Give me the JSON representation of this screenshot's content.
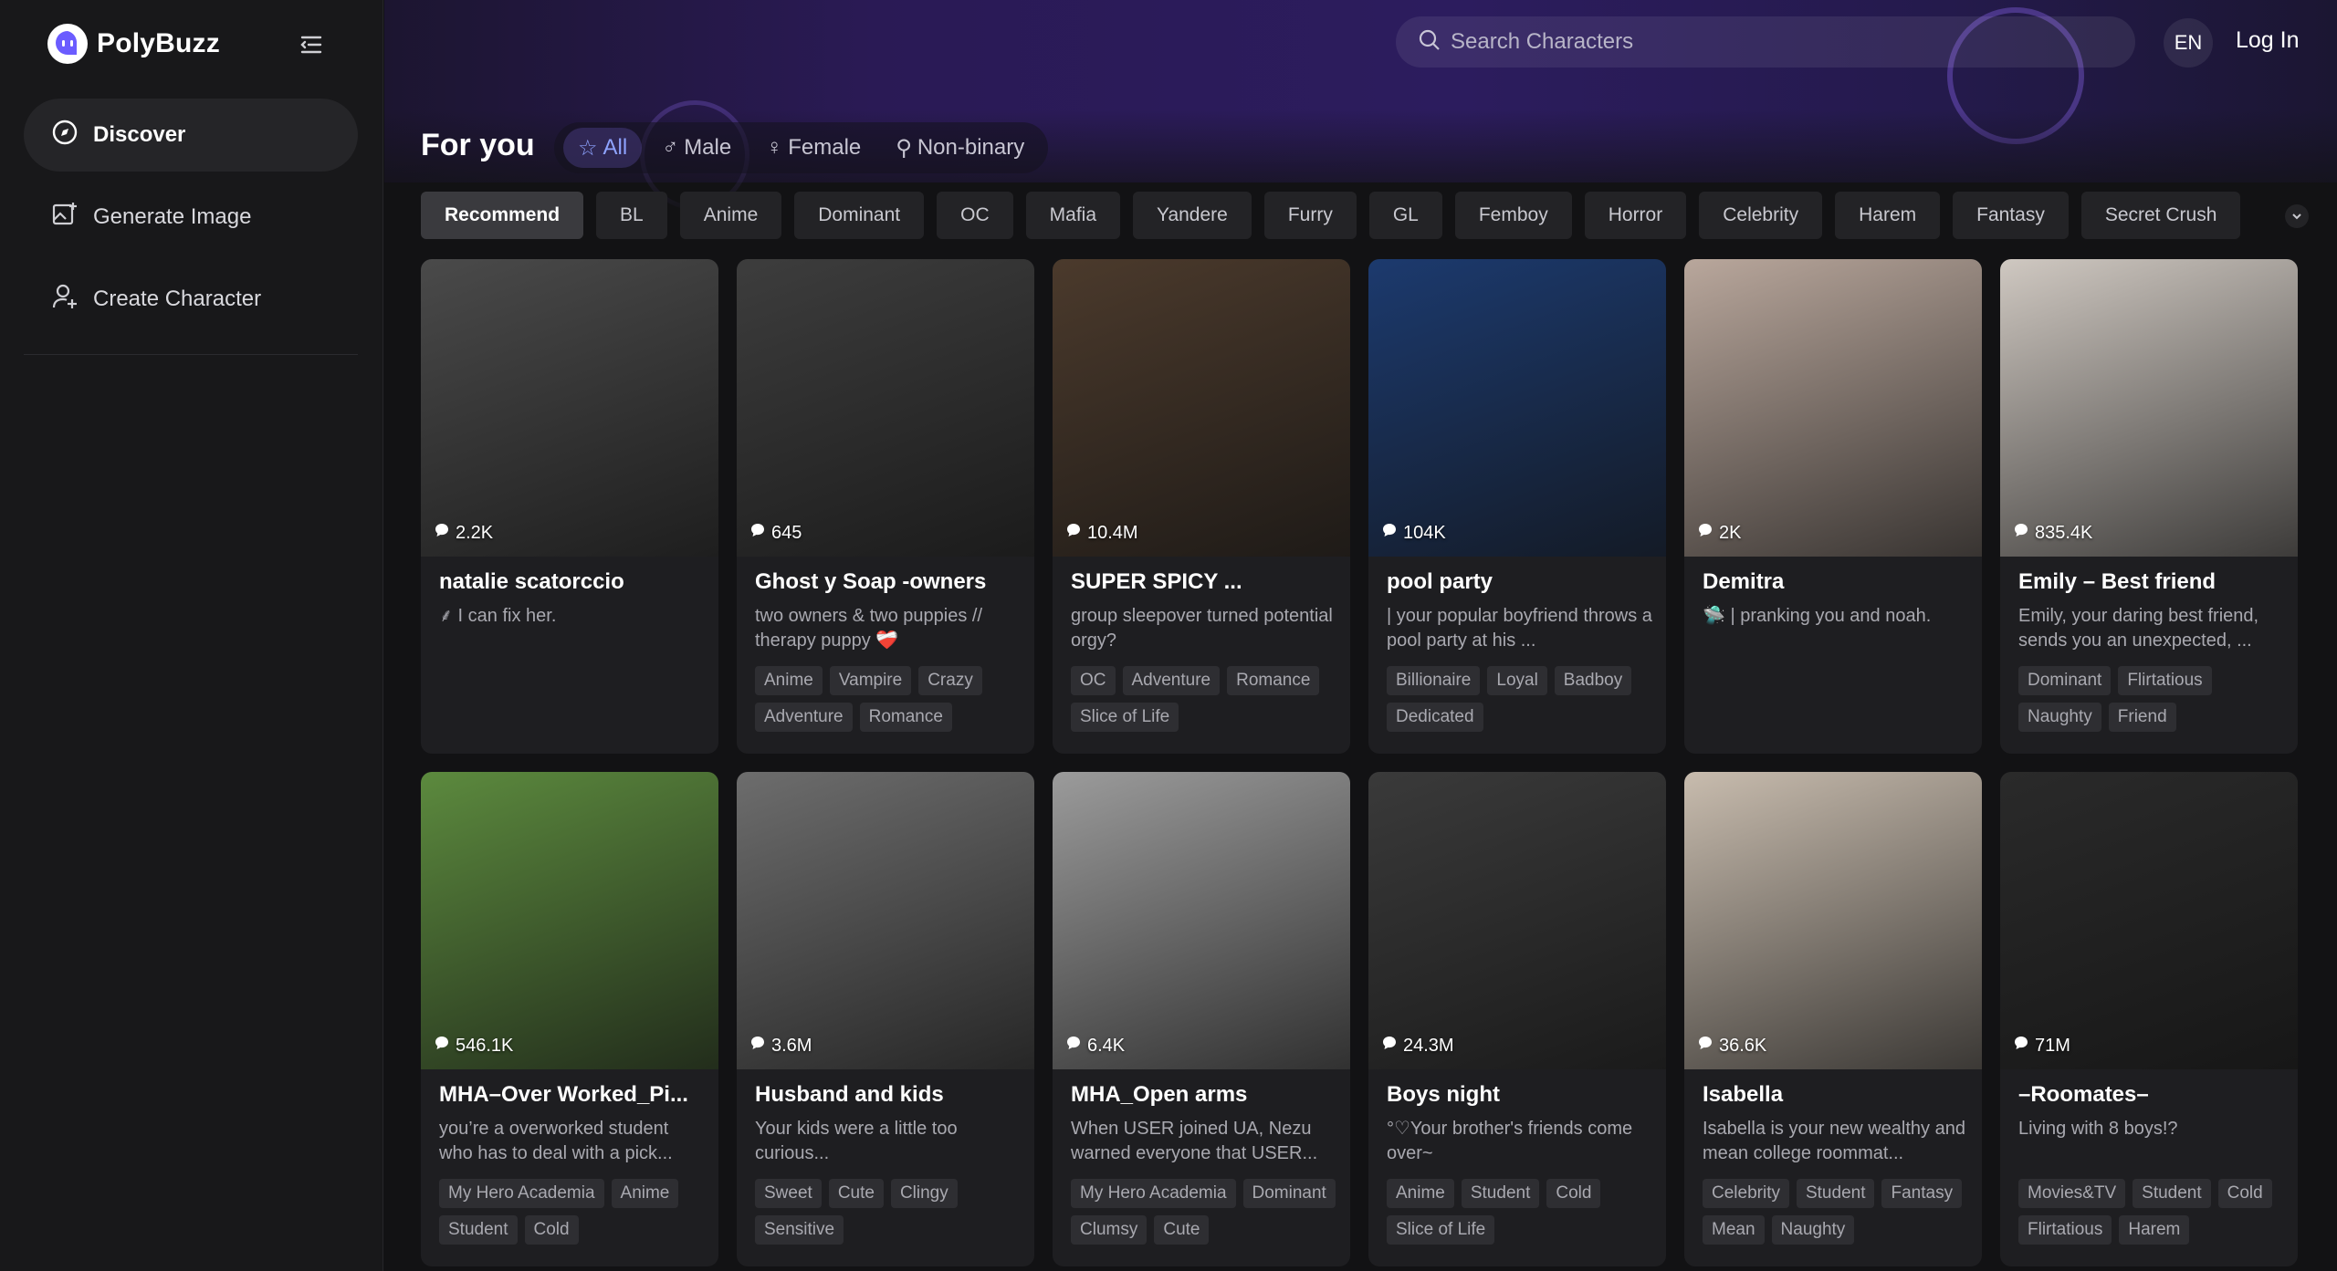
{
  "brand": {
    "name": "PolyBuzz"
  },
  "sidebar": {
    "items": [
      {
        "label": "Discover",
        "icon": "compass-icon",
        "active": true
      },
      {
        "label": "Generate Image",
        "icon": "image-plus-icon",
        "active": false
      },
      {
        "label": "Create Character",
        "icon": "user-plus-icon",
        "active": false
      }
    ]
  },
  "header": {
    "search_placeholder": "Search Characters",
    "lang": "EN",
    "login": "Log In"
  },
  "feed": {
    "title": "For you",
    "gender_tabs": [
      {
        "label": "All",
        "icon": "star-icon"
      },
      {
        "label": "Male",
        "icon": "male-icon"
      },
      {
        "label": "Female",
        "icon": "female-icon"
      },
      {
        "label": "Non-binary",
        "icon": "nonbinary-icon"
      }
    ],
    "categories": [
      "Recommend",
      "BL",
      "Anime",
      "Dominant",
      "OC",
      "Mafia",
      "Yandere",
      "Furry",
      "GL",
      "Femboy",
      "Horror",
      "Celebrity",
      "Harem",
      "Fantasy",
      "Secret Crush"
    ]
  },
  "cards": [
    {
      "count": "2.2K",
      "title": "natalie scatorccio",
      "desc": "⸙ I can fix her.",
      "tags": [],
      "bg": "#4a4a4a"
    },
    {
      "count": "645",
      "title": "Ghost y Soap -owners",
      "desc": "two owners & two puppies // therapy puppy ❤️‍🩹",
      "tags": [
        "Anime",
        "Vampire",
        "Crazy",
        "Adventure",
        "Romance"
      ],
      "bg": "#3d3d3d"
    },
    {
      "count": "10.4M",
      "title": "SUPER SPICY ...",
      "desc": "group sleepover turned potential orgy?",
      "tags": [
        "OC",
        "Adventure",
        "Romance",
        "Slice of Life"
      ],
      "bg": "#4b3a2c"
    },
    {
      "count": "104K",
      "title": "pool party",
      "desc": "| your popular boyfriend throws a pool party at his ...",
      "tags": [
        "Billionaire",
        "Loyal",
        "Badboy",
        "Dedicated"
      ],
      "bg": "#1c3a6e"
    },
    {
      "count": "2K",
      "title": "Demitra",
      "desc": "🛸 | pranking you and noah.",
      "tags": [],
      "bg": "#b9a79c"
    },
    {
      "count": "835.4K",
      "title": "Emily – Best friend",
      "desc": "Emily, your daring best friend, sends you an unexpected, ...",
      "tags": [
        "Dominant",
        "Flirtatious",
        "Naughty",
        "Friend"
      ],
      "bg": "#cfc8c1"
    },
    {
      "count": "546.1K",
      "title": "MHA–Over Worked_Pi...",
      "desc": "you’re a overworked student who has to deal with a pick...",
      "tags": [
        "My Hero Academia",
        "Anime",
        "Student",
        "Cold"
      ],
      "bg": "#5c8a3e"
    },
    {
      "count": "3.6M",
      "title": "Husband and kids",
      "desc": "Your kids were a little too curious...",
      "tags": [
        "Sweet",
        "Cute",
        "Clingy",
        "Sensitive"
      ],
      "bg": "#6d6d6d"
    },
    {
      "count": "6.4K",
      "title": "MHA_Open arms",
      "desc": "When USER joined UA, Nezu warned everyone that USER...",
      "tags": [
        "My Hero Academia",
        "Dominant",
        "Clumsy",
        "Cute"
      ],
      "bg": "#9b9b9b"
    },
    {
      "count": "24.3M",
      "title": "Boys night",
      "desc": "°♡Your brother's friends come over~",
      "tags": [
        "Anime",
        "Student",
        "Cold",
        "Slice of Life"
      ],
      "bg": "#3a3a3a"
    },
    {
      "count": "36.6K",
      "title": "Isabella",
      "desc": "Isabella is your new wealthy and mean college roommat...",
      "tags": [
        "Celebrity",
        "Student",
        "Fantasy",
        "Mean",
        "Naughty"
      ],
      "bg": "#c8bcae"
    },
    {
      "count": "71M",
      "title": "–Roomates–",
      "desc": "Living with 8 boys!?",
      "tags": [
        "Movies&TV",
        "Student",
        "Cold",
        "Flirtatious",
        "Harem"
      ],
      "bg": "#2a2a2a"
    }
  ]
}
